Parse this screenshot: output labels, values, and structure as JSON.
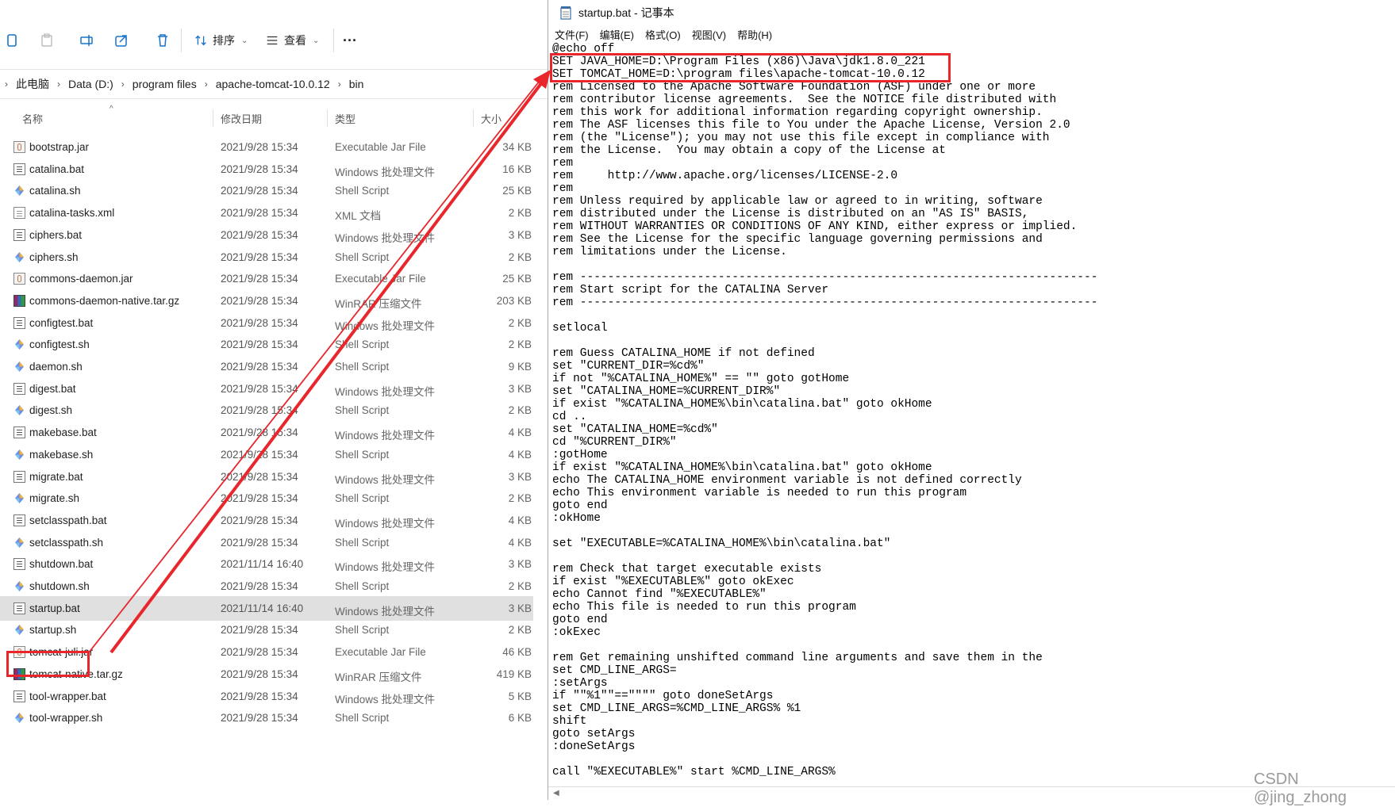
{
  "explorer": {
    "toolbar": {
      "sort_label": "排序",
      "view_label": "查看",
      "more_label": "···"
    },
    "breadcrumb": [
      "此电脑",
      "Data (D:)",
      "program files",
      "apache-tomcat-10.0.12",
      "bin"
    ],
    "columns": {
      "name": "名称",
      "date": "修改日期",
      "type": "类型",
      "size": "大小"
    },
    "files": [
      {
        "name": "bootstrap.jar",
        "date": "2021/9/28 15:34",
        "type": "Executable Jar File",
        "size": "34 KB",
        "icon": "jar"
      },
      {
        "name": "catalina.bat",
        "date": "2021/9/28 15:34",
        "type": "Windows 批处理文件",
        "size": "16 KB",
        "icon": "bat"
      },
      {
        "name": "catalina.sh",
        "date": "2021/9/28 15:34",
        "type": "Shell Script",
        "size": "25 KB",
        "icon": "sh"
      },
      {
        "name": "catalina-tasks.xml",
        "date": "2021/9/28 15:34",
        "type": "XML 文档",
        "size": "2 KB",
        "icon": "xml"
      },
      {
        "name": "ciphers.bat",
        "date": "2021/9/28 15:34",
        "type": "Windows 批处理文件",
        "size": "3 KB",
        "icon": "bat"
      },
      {
        "name": "ciphers.sh",
        "date": "2021/9/28 15:34",
        "type": "Shell Script",
        "size": "2 KB",
        "icon": "sh"
      },
      {
        "name": "commons-daemon.jar",
        "date": "2021/9/28 15:34",
        "type": "Executable Jar File",
        "size": "25 KB",
        "icon": "jar"
      },
      {
        "name": "commons-daemon-native.tar.gz",
        "date": "2021/9/28 15:34",
        "type": "WinRAR 压缩文件",
        "size": "203 KB",
        "icon": "rar"
      },
      {
        "name": "configtest.bat",
        "date": "2021/9/28 15:34",
        "type": "Windows 批处理文件",
        "size": "2 KB",
        "icon": "bat"
      },
      {
        "name": "configtest.sh",
        "date": "2021/9/28 15:34",
        "type": "Shell Script",
        "size": "2 KB",
        "icon": "sh"
      },
      {
        "name": "daemon.sh",
        "date": "2021/9/28 15:34",
        "type": "Shell Script",
        "size": "9 KB",
        "icon": "sh"
      },
      {
        "name": "digest.bat",
        "date": "2021/9/28 15:34",
        "type": "Windows 批处理文件",
        "size": "3 KB",
        "icon": "bat"
      },
      {
        "name": "digest.sh",
        "date": "2021/9/28 15:34",
        "type": "Shell Script",
        "size": "2 KB",
        "icon": "sh"
      },
      {
        "name": "makebase.bat",
        "date": "2021/9/28 15:34",
        "type": "Windows 批处理文件",
        "size": "4 KB",
        "icon": "bat"
      },
      {
        "name": "makebase.sh",
        "date": "2021/9/28 15:34",
        "type": "Shell Script",
        "size": "4 KB",
        "icon": "sh"
      },
      {
        "name": "migrate.bat",
        "date": "2021/9/28 15:34",
        "type": "Windows 批处理文件",
        "size": "3 KB",
        "icon": "bat"
      },
      {
        "name": "migrate.sh",
        "date": "2021/9/28 15:34",
        "type": "Shell Script",
        "size": "2 KB",
        "icon": "sh"
      },
      {
        "name": "setclasspath.bat",
        "date": "2021/9/28 15:34",
        "type": "Windows 批处理文件",
        "size": "4 KB",
        "icon": "bat"
      },
      {
        "name": "setclasspath.sh",
        "date": "2021/9/28 15:34",
        "type": "Shell Script",
        "size": "4 KB",
        "icon": "sh"
      },
      {
        "name": "shutdown.bat",
        "date": "2021/11/14 16:40",
        "type": "Windows 批处理文件",
        "size": "3 KB",
        "icon": "bat"
      },
      {
        "name": "shutdown.sh",
        "date": "2021/9/28 15:34",
        "type": "Shell Script",
        "size": "2 KB",
        "icon": "sh"
      },
      {
        "name": "startup.bat",
        "date": "2021/11/14 16:40",
        "type": "Windows 批处理文件",
        "size": "3 KB",
        "icon": "bat",
        "selected": true
      },
      {
        "name": "startup.sh",
        "date": "2021/9/28 15:34",
        "type": "Shell Script",
        "size": "2 KB",
        "icon": "sh"
      },
      {
        "name": "tomcat-juli.jar",
        "date": "2021/9/28 15:34",
        "type": "Executable Jar File",
        "size": "46 KB",
        "icon": "jar"
      },
      {
        "name": "tomcat-native.tar.gz",
        "date": "2021/9/28 15:34",
        "type": "WinRAR 压缩文件",
        "size": "419 KB",
        "icon": "rar"
      },
      {
        "name": "tool-wrapper.bat",
        "date": "2021/9/28 15:34",
        "type": "Windows 批处理文件",
        "size": "5 KB",
        "icon": "bat"
      },
      {
        "name": "tool-wrapper.sh",
        "date": "2021/9/28 15:34",
        "type": "Shell Script",
        "size": "6 KB",
        "icon": "sh"
      }
    ]
  },
  "notepad": {
    "title": "startup.bat - 记事本",
    "menu": [
      "文件(F)",
      "编辑(E)",
      "格式(O)",
      "视图(V)",
      "帮助(H)"
    ],
    "content": "@echo off\nSET JAVA_HOME=D:\\Program Files (x86)\\Java\\jdk1.8.0_221\nSET TOMCAT_HOME=D:\\program files\\apache-tomcat-10.0.12\nrem Licensed to the Apache Software Foundation (ASF) under one or more\nrem contributor license agreements.  See the NOTICE file distributed with\nrem this work for additional information regarding copyright ownership.\nrem The ASF licenses this file to You under the Apache License, Version 2.0\nrem (the \"License\"); you may not use this file except in compliance with\nrem the License.  You may obtain a copy of the License at\nrem\nrem     http://www.apache.org/licenses/LICENSE-2.0\nrem\nrem Unless required by applicable law or agreed to in writing, software\nrem distributed under the License is distributed on an \"AS IS\" BASIS,\nrem WITHOUT WARRANTIES OR CONDITIONS OF ANY KIND, either express or implied.\nrem See the License for the specific language governing permissions and\nrem limitations under the License.\n\nrem ---------------------------------------------------------------------------\nrem Start script for the CATALINA Server\nrem ---------------------------------------------------------------------------\n\nsetlocal\n\nrem Guess CATALINA_HOME if not defined\nset \"CURRENT_DIR=%cd%\"\nif not \"%CATALINA_HOME%\" == \"\" goto gotHome\nset \"CATALINA_HOME=%CURRENT_DIR%\"\nif exist \"%CATALINA_HOME%\\bin\\catalina.bat\" goto okHome\ncd ..\nset \"CATALINA_HOME=%cd%\"\ncd \"%CURRENT_DIR%\"\n:gotHome\nif exist \"%CATALINA_HOME%\\bin\\catalina.bat\" goto okHome\necho The CATALINA_HOME environment variable is not defined correctly\necho This environment variable is needed to run this program\ngoto end\n:okHome\n\nset \"EXECUTABLE=%CATALINA_HOME%\\bin\\catalina.bat\"\n\nrem Check that target executable exists\nif exist \"%EXECUTABLE%\" goto okExec\necho Cannot find \"%EXECUTABLE%\"\necho This file is needed to run this program\ngoto end\n:okExec\n\nrem Get remaining unshifted command line arguments and save them in the\nset CMD_LINE_ARGS=\n:setArgs\nif \"\"%1\"\"==\"\"\"\" goto doneSetArgs\nset CMD_LINE_ARGS=%CMD_LINE_ARGS% %1\nshift\ngoto setArgs\n:doneSetArgs\n\ncall \"%EXECUTABLE%\" start %CMD_LINE_ARGS%"
  },
  "watermark": "CSDN @jing_zhong",
  "colors": {
    "highlight": "#e8262b",
    "selected_row": "#e0e0e0"
  }
}
